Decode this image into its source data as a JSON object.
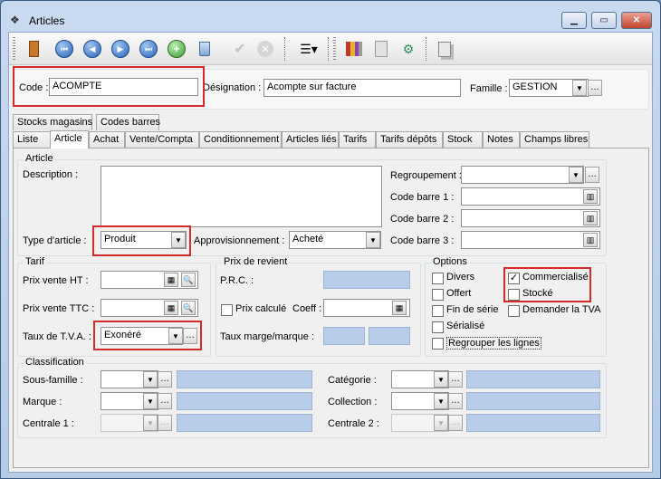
{
  "window": {
    "title": "Articles"
  },
  "header": {
    "code_label": "Code :",
    "code_value": "ACOMPTE",
    "designation_label": "Désignation :",
    "designation_value": "Acompte sur facture",
    "famille_label": "Famille :",
    "famille_value": "GESTION"
  },
  "tabs_row1": [
    "Stocks magasins",
    "Codes barres"
  ],
  "tabs_row2": [
    "Liste",
    "Article",
    "Achat",
    "Vente/Compta",
    "Conditionnement",
    "Articles liés",
    "Tarifs",
    "Tarifs dépôts",
    "Stock",
    "Notes",
    "Champs libres"
  ],
  "active_tab": "Article",
  "article_group": {
    "title": "Article",
    "description_label": "Description :",
    "description_value": "",
    "type_label": "Type d'article :",
    "type_value": "Produit",
    "appro_label": "Approvisionnement :",
    "appro_value": "Acheté",
    "regroupement_label": "Regroupement :",
    "regroupement_value": "",
    "cb1_label": "Code barre 1 :",
    "cb2_label": "Code barre 2 :",
    "cb3_label": "Code barre 3 :"
  },
  "tarif_group": {
    "title": "Tarif",
    "pvht_label": "Prix vente HT :",
    "pvttc_label": "Prix vente TTC :",
    "tva_label": "Taux de T.V.A. :",
    "tva_value": "Exonéré"
  },
  "revient_group": {
    "title": "Prix de revient",
    "prc_label": "P.R.C. :",
    "prix_calcule_label": "Prix calculé",
    "coeff_label": "Coeff :",
    "taux_marge_label": "Taux marge/marque :"
  },
  "options_group": {
    "title": "Options",
    "divers": {
      "label": "Divers",
      "checked": false
    },
    "commercialise": {
      "label": "Commercialisé",
      "checked": true
    },
    "offert": {
      "label": "Offert",
      "checked": false
    },
    "stocke": {
      "label": "Stocké",
      "checked": false
    },
    "fin_serie": {
      "label": "Fin de série",
      "checked": false
    },
    "demander_tva": {
      "label": "Demander la TVA",
      "checked": false
    },
    "serialise": {
      "label": "Sérialisé",
      "checked": false
    },
    "regrouper": {
      "label": "Regrouper les lignes",
      "checked": false
    }
  },
  "classification_group": {
    "title": "Classification",
    "sous_famille_label": "Sous-famille :",
    "marque_label": "Marque :",
    "centrale1_label": "Centrale 1 :",
    "categorie_label": "Catégorie :",
    "collection_label": "Collection :",
    "centrale2_label": "Centrale 2 :"
  },
  "toolbar": {
    "icons": [
      "exit-door-icon",
      "first-record-icon",
      "previous-record-icon",
      "next-record-icon",
      "last-record-icon",
      "add-record-icon",
      "delete-record-icon",
      "validate-icon",
      "cancel-icon",
      "list-menu-icon",
      "books-icon",
      "document-icon",
      "tools-icon",
      "copy-icon"
    ]
  },
  "colors": {
    "highlight": "#d42a2a",
    "readonly_field": "#b7cdea"
  }
}
